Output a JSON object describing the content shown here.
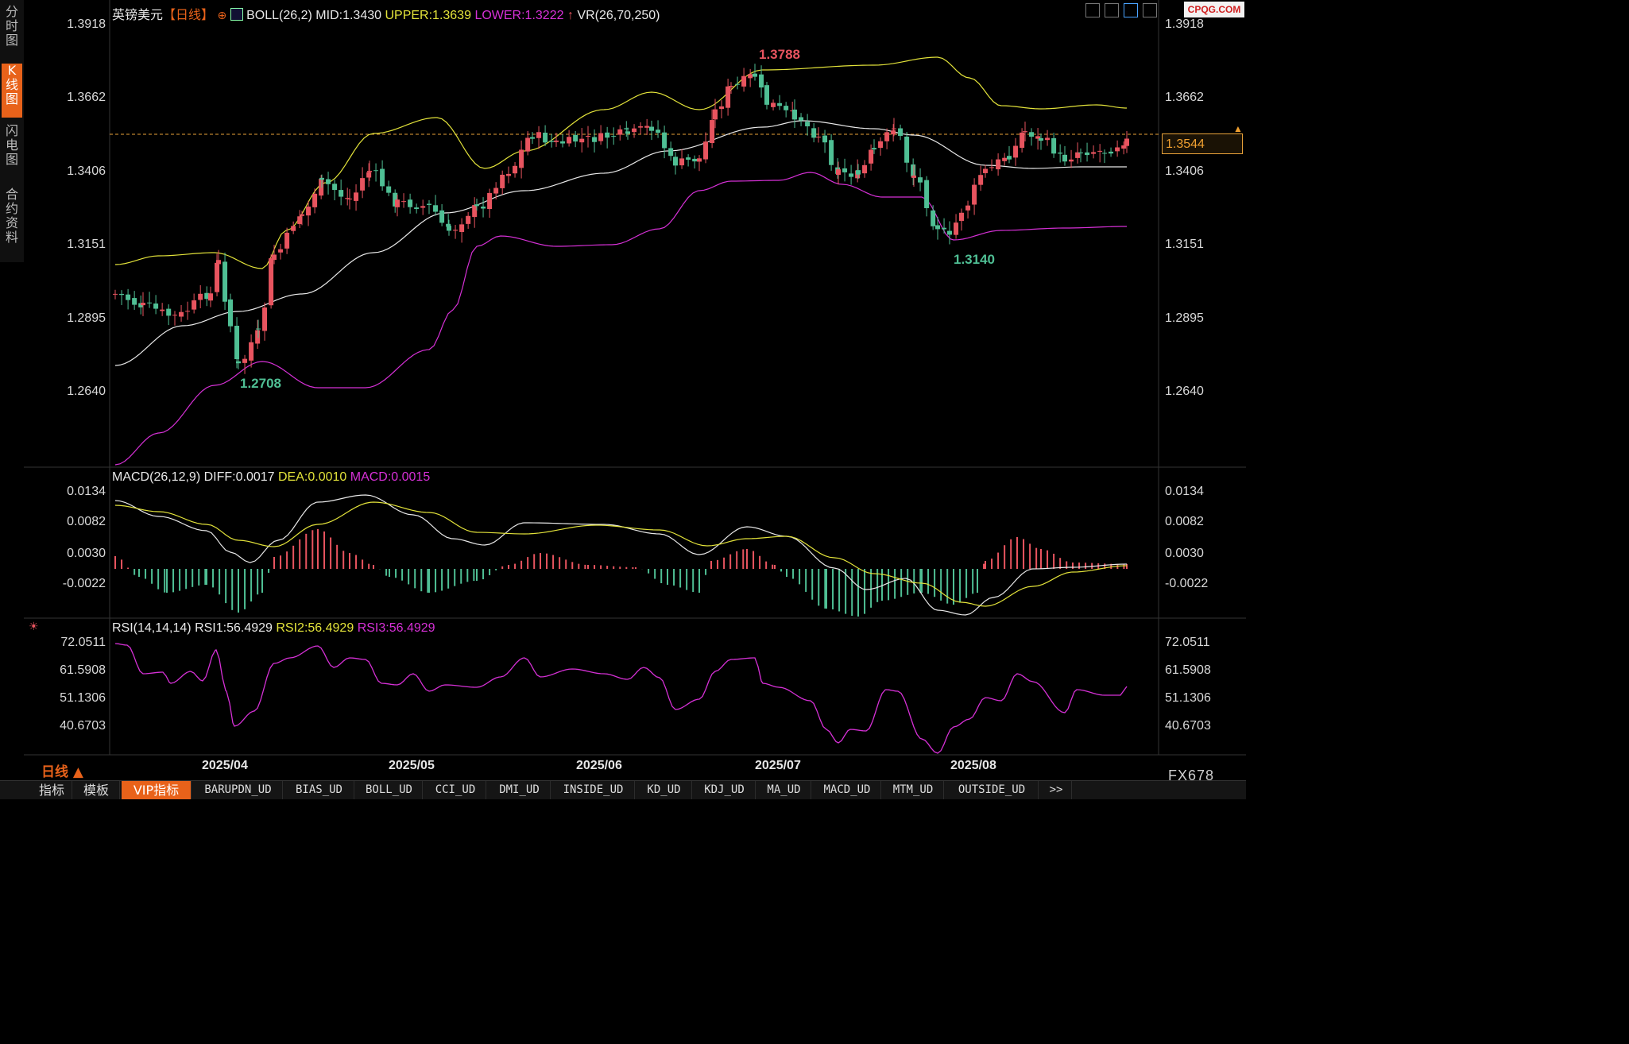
{
  "sidebar": {
    "items": [
      {
        "label": "分时图",
        "active": false
      },
      {
        "label": "K线图",
        "active": true
      },
      {
        "label": "闪电图",
        "active": false
      },
      {
        "label": "合约资料",
        "active": false
      }
    ]
  },
  "main_header": {
    "symbol": "英镑美元",
    "period": "【日线】",
    "boll_name": "BOLL(26,2)",
    "mid": "MID:1.3430",
    "upper": "UPPER:1.3639",
    "lower": "LOWER:1.3222",
    "vr": "VR(26,70,250)"
  },
  "watermark": "CPQG.COM",
  "price_axis": [
    "1.3918",
    "1.3662",
    "1.3406",
    "1.3151",
    "1.2895",
    "1.2640"
  ],
  "current_price": "1.3544",
  "annotations": {
    "high": "1.3788",
    "low_mid": "1.3140",
    "low_left": "1.2708"
  },
  "macd_header": {
    "name": "MACD(26,12,9)",
    "diff": "DIFF:0.0017",
    "dea": "DEA:0.0010",
    "macd": "MACD:0.0015"
  },
  "macd_axis": [
    "0.0134",
    "0.0082",
    "0.0030",
    "-0.0022"
  ],
  "rsi_header": {
    "name": "RSI(14,14,14)",
    "rsi1": "RSI1:56.4929",
    "rsi2": "RSI2:56.4929",
    "rsi3": "RSI3:56.4929"
  },
  "rsi_axis": [
    "72.0511",
    "61.5908",
    "51.1306",
    "40.6703"
  ],
  "dates": [
    "2025/04",
    "2025/05",
    "2025/06",
    "2025/07",
    "2025/08"
  ],
  "period_footer": "日线 ▲",
  "brand": "FX678",
  "bottom_tabs": [
    {
      "label": "指标",
      "active": false
    },
    {
      "label": "模板",
      "active": false
    },
    {
      "label": "VIP指标",
      "active": true
    },
    {
      "label": "BARUPDN_UD",
      "active": false
    },
    {
      "label": "BIAS_UD",
      "active": false
    },
    {
      "label": "BOLL_UD",
      "active": false
    },
    {
      "label": "CCI_UD",
      "active": false
    },
    {
      "label": "DMI_UD",
      "active": false
    },
    {
      "label": "INSIDE_UD",
      "active": false
    },
    {
      "label": "KD_UD",
      "active": false
    },
    {
      "label": "KDJ_UD",
      "active": false
    },
    {
      "label": "MA_UD",
      "active": false
    },
    {
      "label": "MACD_UD",
      "active": false
    },
    {
      "label": "MTM_UD",
      "active": false
    },
    {
      "label": "OUTSIDE_UD",
      "active": false
    },
    {
      "label": ">>",
      "active": false
    }
  ],
  "colors": {
    "up": "#e8545f",
    "down": "#4fbf94",
    "mid": "#e8e8e8",
    "upper": "#e3e33a",
    "lower": "#d630d6",
    "accent": "#e8621a"
  }
}
